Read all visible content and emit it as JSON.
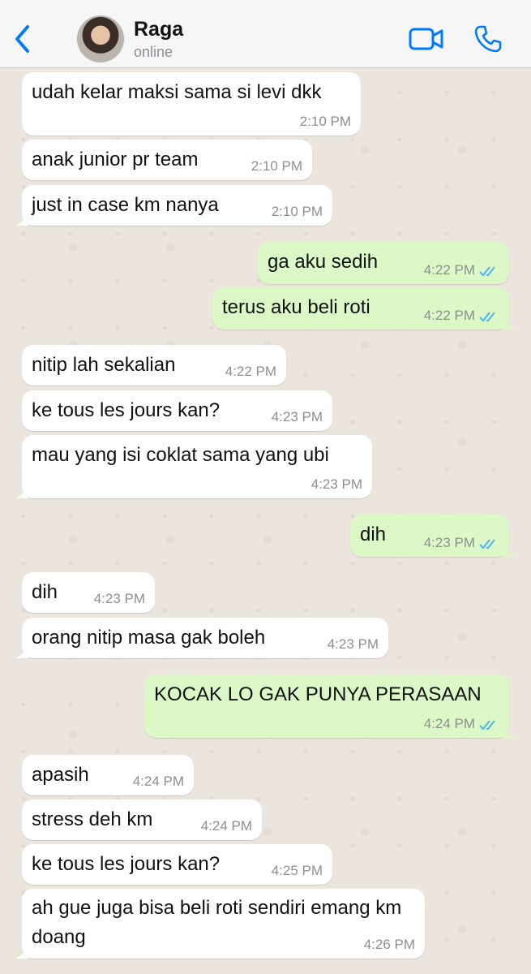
{
  "header": {
    "name": "Raga",
    "status": "online"
  },
  "colors": {
    "accent": "#007aff",
    "incoming_bubble": "#ffffff",
    "outgoing_bubble": "#dcf8c6",
    "read_ticks": "#4fb6ec",
    "wallpaper": "#ece5dd"
  },
  "icons": {
    "back": "chevron-left-icon",
    "video": "video-camera-icon",
    "call": "phone-icon",
    "read_receipt": "double-check-icon"
  },
  "messages": [
    {
      "dir": "in",
      "text": "udah kelar maksi sama si levi dkk",
      "time": "2:10 PM"
    },
    {
      "dir": "in",
      "text": "anak junior pr team",
      "time": "2:10 PM"
    },
    {
      "dir": "in",
      "text": "just in case km nanya",
      "time": "2:10 PM"
    },
    {
      "dir": "out",
      "text": "ga aku sedih",
      "time": "4:22 PM"
    },
    {
      "dir": "out",
      "text": "terus aku beli roti",
      "time": "4:22 PM"
    },
    {
      "dir": "in",
      "text": "nitip lah sekalian",
      "time": "4:22 PM"
    },
    {
      "dir": "in",
      "text": "ke tous les jours kan?",
      "time": "4:23 PM"
    },
    {
      "dir": "in",
      "text": "mau yang isi coklat sama yang ubi",
      "time": "4:23 PM"
    },
    {
      "dir": "out",
      "text": "dih",
      "time": "4:23 PM"
    },
    {
      "dir": "in",
      "text": "dih",
      "time": "4:23 PM"
    },
    {
      "dir": "in",
      "text": "orang nitip masa gak boleh",
      "time": "4:23 PM"
    },
    {
      "dir": "out",
      "text": "KOCAK LO GAK PUNYA PERASAAN",
      "time": "4:24 PM"
    },
    {
      "dir": "in",
      "text": "apasih",
      "time": "4:24 PM"
    },
    {
      "dir": "in",
      "text": "stress deh km",
      "time": "4:24 PM"
    },
    {
      "dir": "in",
      "text": "ke tous les jours kan?",
      "time": "4:25 PM"
    },
    {
      "dir": "in",
      "text": "ah gue juga bisa beli roti sendiri emang km doang",
      "time": "4:26 PM"
    }
  ]
}
